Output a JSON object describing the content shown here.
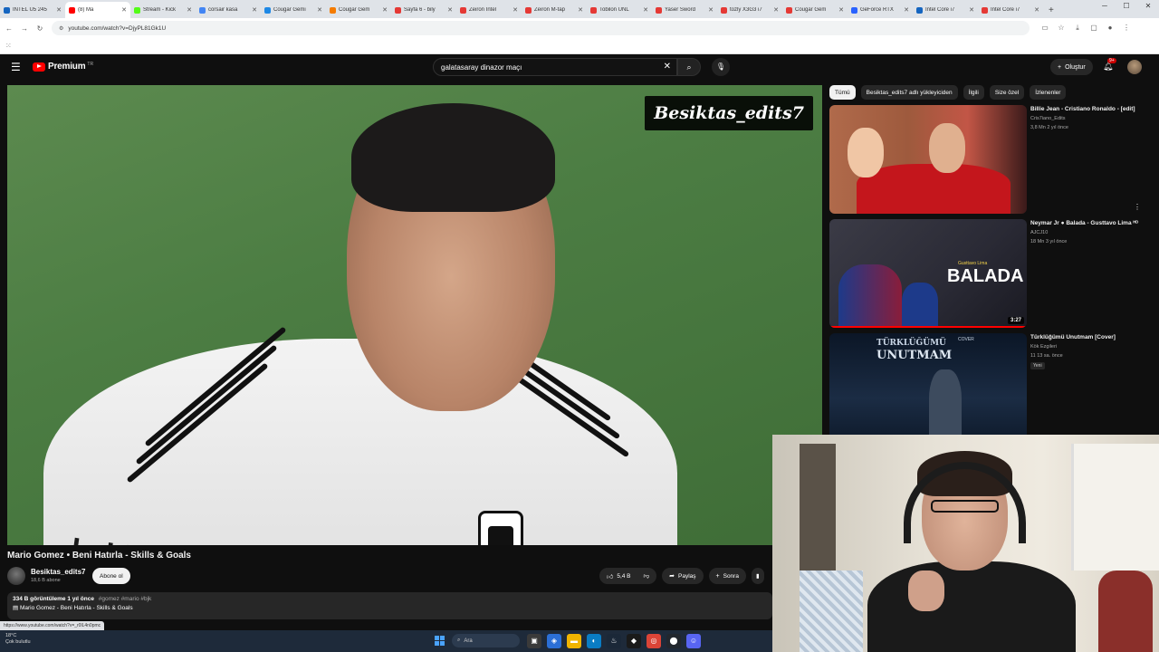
{
  "browser": {
    "tabs": [
      {
        "label": "INTEL U5 245",
        "color": "#1565c0"
      },
      {
        "label": "(8) Ma",
        "color": "#ff0000",
        "active": true
      },
      {
        "label": "Stream - Kick",
        "color": "#53fc18"
      },
      {
        "label": "corsair kasa",
        "color": "#4285f4"
      },
      {
        "label": "Cougar Gemi",
        "color": "#1e88e5"
      },
      {
        "label": "Cougar Gem",
        "color": "#f57c00"
      },
      {
        "label": "Sayfa 6 - bily",
        "color": "#e53935"
      },
      {
        "label": "Zeiron Intel",
        "color": "#e53935"
      },
      {
        "label": "Zeiron M-tap",
        "color": "#e53935"
      },
      {
        "label": "Tobilon UNL",
        "color": "#e53935"
      },
      {
        "label": "Yaser Sword",
        "color": "#e53935"
      },
      {
        "label": "tozly X3G3 i7",
        "color": "#e53935"
      },
      {
        "label": "Cougar Gem",
        "color": "#e53935"
      },
      {
        "label": "GeForce RTX",
        "color": "#2962ff"
      },
      {
        "label": "Intel Core i7",
        "color": "#1565c0"
      },
      {
        "label": "Intel Core i7",
        "color": "#e53935"
      }
    ],
    "url": "youtube.com/watch?v=DjyPL81Gk1U",
    "status_url": "https://www.youtube.com/watch?v=_r0lL4n0pmc"
  },
  "youtube": {
    "logo_text": "Premium",
    "logo_region": "TR",
    "search_query": "galatasaray dinazor maçı",
    "create_label": "Oluştur",
    "notif_count": "9+"
  },
  "video": {
    "watermark": "Besiktas_edits7",
    "sponsor_text": "kalde",
    "brand_text": "adidas",
    "title": "Mario Gomez • Beni Hatırla - Skills & Goals",
    "channel": "Besiktas_edits7",
    "subscribers": "18,6 B abone",
    "subscribe_label": "Abone ol",
    "likes": "5,4 B",
    "share_label": "Paylaş",
    "save_label": "Sonra",
    "views_date": "334 B görüntüleme  1 yıl önce",
    "hashtags": "#gomez #mario #bjk",
    "desc_line": "Mario Gomez - Beni Hatırla - Skills & Goals"
  },
  "chips": [
    "Tümü",
    "Besiktas_edits7 adlı yükleyiciden",
    "İlgili",
    "Size özel",
    "İzlenenler"
  ],
  "recommendations": [
    {
      "title": "Billie Jean - Cristiano Ronaldo - [edit]",
      "channel": "Cris7iano_Edits",
      "meta": "3,8 Mn  2 yıl önce"
    },
    {
      "title": "Neymar Jr ● Balada - Gusttavo Lima ᴴᴰ",
      "channel": "AJCJ10",
      "meta": "18 Mn  3 yıl önce",
      "duration": "3:27",
      "thumb_text": "BALADA",
      "thumb_sub": "Gusttavo Lima",
      "watched_pct": 100
    },
    {
      "title": "Türklüğümü Unutmam [Cover]",
      "channel": "Kök Ezgileri",
      "meta": "11  13 sa. önce",
      "badge": "Yeni",
      "thumb_line1": "TÜRKLÜĞÜMÜ",
      "thumb_line2": "UNUTMAM",
      "thumb_tag": "COVER"
    }
  ],
  "taskbar": {
    "temp": "18°C",
    "weather": "Çok bulutlu",
    "search_placeholder": "Ara"
  }
}
